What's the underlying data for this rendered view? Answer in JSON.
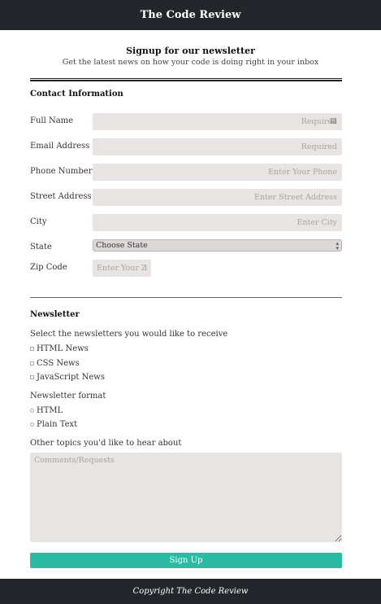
{
  "header": {
    "title": "The Code Review"
  },
  "intro": {
    "title": "Signup for our newsletter",
    "subtitle": "Get the latest news on how your code is doing right in your inbox"
  },
  "contact": {
    "heading": "Contact Information",
    "full_name": {
      "label": "Full Name",
      "placeholder": "Required"
    },
    "email": {
      "label": "Email Address",
      "placeholder": "Required"
    },
    "phone": {
      "label": "Phone Number",
      "placeholder": "Enter Your Phone"
    },
    "street": {
      "label": "Street Address",
      "placeholder": "Enter Street Address"
    },
    "city": {
      "label": "City",
      "placeholder": "Enter City"
    },
    "state": {
      "label": "State",
      "selected": "Choose State"
    },
    "zip": {
      "label": "Zip Code",
      "placeholder": "Enter Your Z"
    }
  },
  "newsletter": {
    "heading": "Newsletter",
    "select_prompt": "Select the newsletters you would like to receive",
    "options": [
      "HTML News",
      "CSS News",
      "JavaScript News"
    ],
    "format_label": "Newsletter format",
    "formats": [
      "HTML",
      "Plain Text"
    ],
    "topics_label": "Other topics you'd like to hear about",
    "comments_placeholder": "Comments/Requests",
    "submit_label": "Sign Up"
  },
  "footer": {
    "text": "Copyright The Code Review"
  },
  "colors": {
    "header_bg": "#23262b",
    "accent": "#2bbba4",
    "field_bg": "#e8e4e3"
  }
}
